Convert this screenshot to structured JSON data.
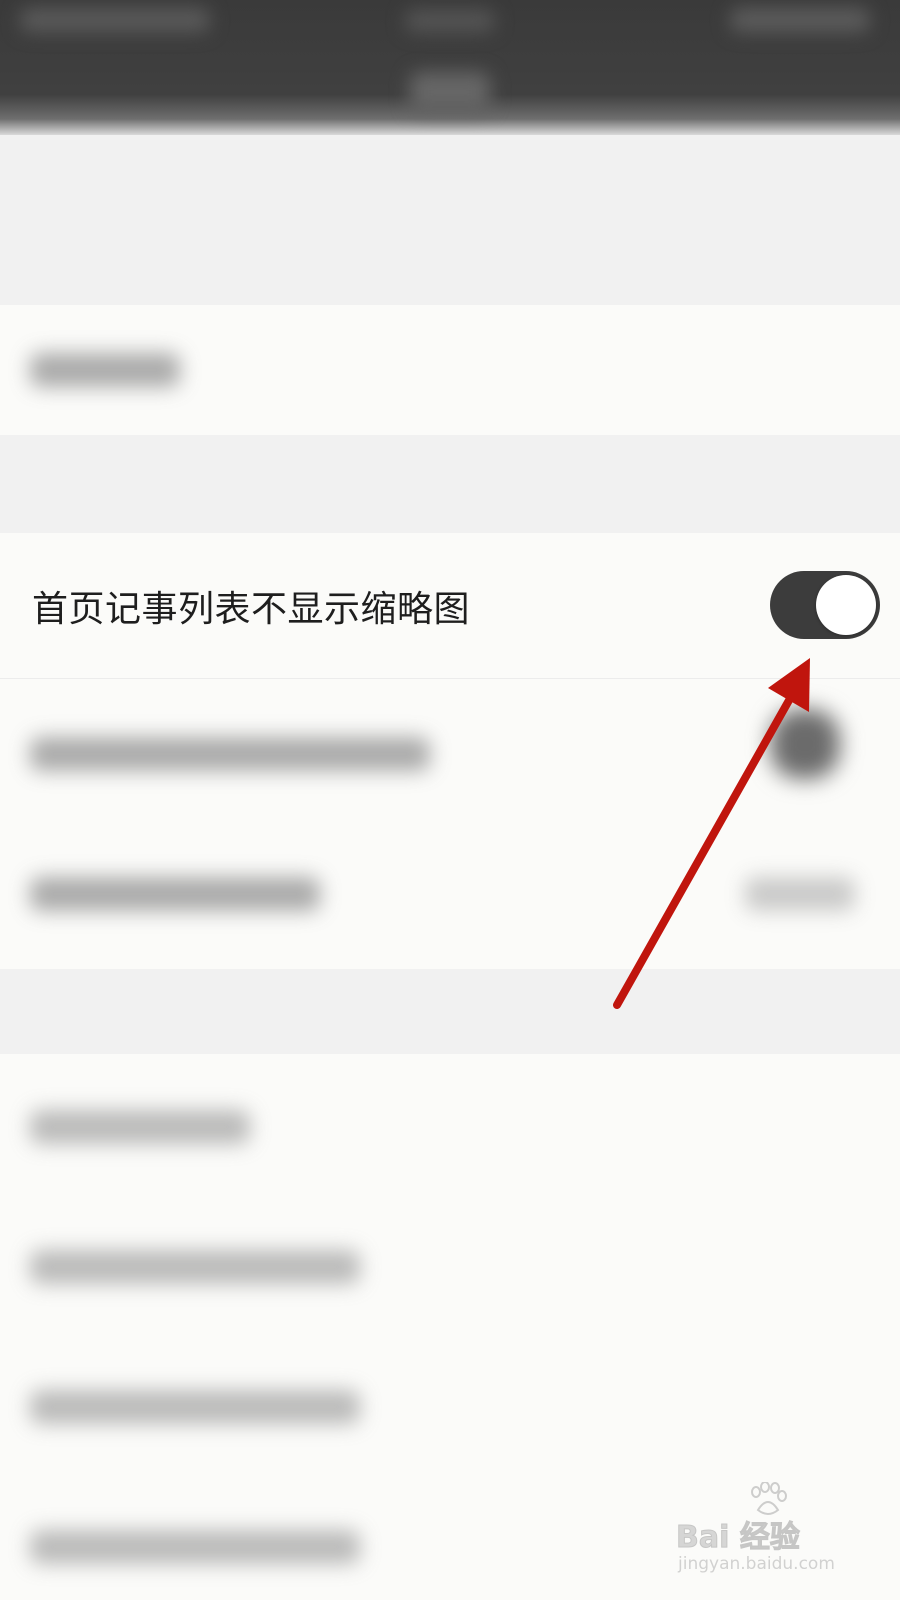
{
  "setting_row": {
    "label": "首页记事列表不显示缩略图",
    "toggle_on": true
  },
  "colors": {
    "toggle_track": "#3c3c3c",
    "toggle_knob": "#ffffff",
    "arrow": "#c0150d",
    "top_bar": "#3a3a3a"
  },
  "icons": {
    "annotation_arrow": "arrow-pointing-to-toggle",
    "watermark_paw": "paw-icon"
  },
  "watermark": {
    "logo": "Bai  经验",
    "url": "jingyan.baidu.com"
  }
}
